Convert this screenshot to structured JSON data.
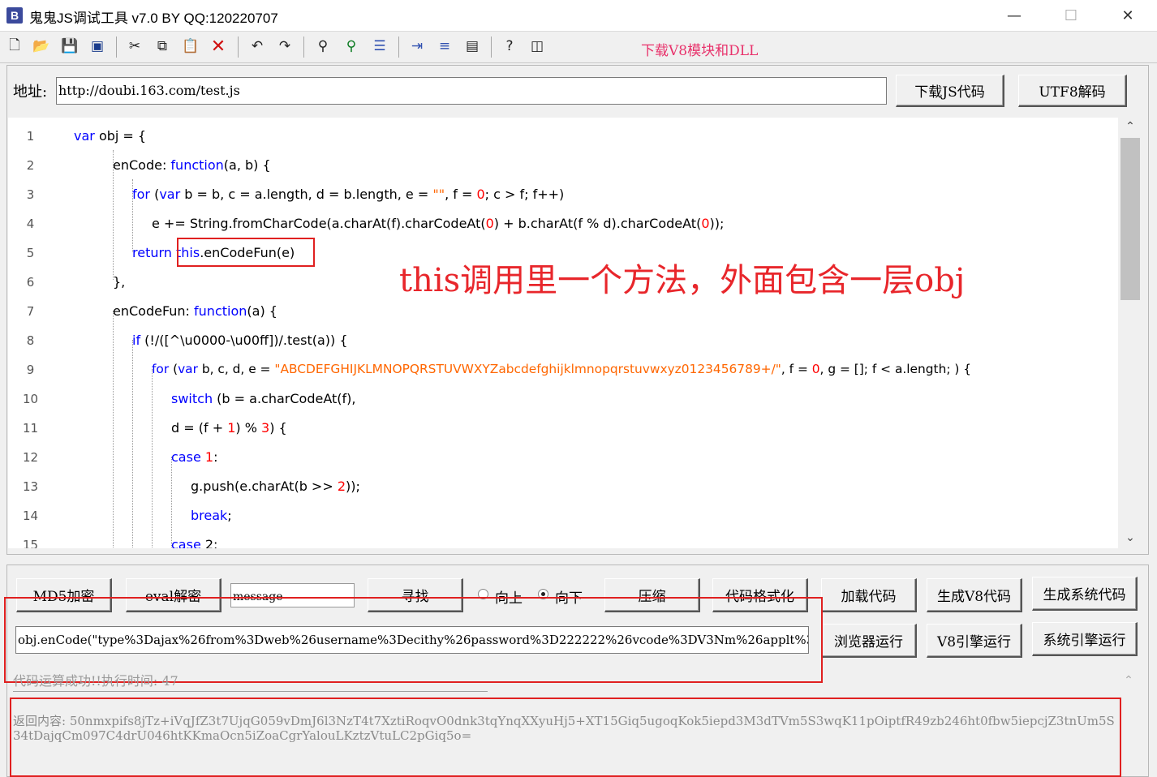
{
  "window": {
    "title": "鬼鬼JS调试工具 v7.0 BY QQ:120220707",
    "icon_letter": "B",
    "controls": {
      "minimize": "—",
      "maximize": "☐",
      "close": "✕"
    }
  },
  "toolbar": {
    "icons": [
      "new-file-icon",
      "open-folder-icon",
      "save-icon",
      "save-all-icon",
      "cut-icon",
      "copy-icon",
      "paste-icon",
      "delete-icon",
      "undo-icon",
      "redo-icon",
      "find-icon",
      "find-next-icon",
      "list-icon",
      "indent-icon",
      "numbered-list-icon",
      "window-icon",
      "help-icon",
      "split-icon"
    ],
    "download_v8_link": "下载V8模块和DLL"
  },
  "address": {
    "label": "地址:",
    "value": "http://doubi.163.com/test.js",
    "download_button": "下载JS代码",
    "utf8_button": "UTF8解码"
  },
  "editor": {
    "lines": [
      {
        "n": "1"
      },
      {
        "n": "2"
      },
      {
        "n": "3"
      },
      {
        "n": "4"
      },
      {
        "n": "5"
      },
      {
        "n": "6"
      },
      {
        "n": "7"
      },
      {
        "n": "8"
      },
      {
        "n": "9"
      },
      {
        "n": "10"
      },
      {
        "n": "11"
      },
      {
        "n": "12"
      },
      {
        "n": "13"
      },
      {
        "n": "14"
      },
      {
        "n": "15"
      }
    ],
    "code": {
      "l1_kw": "var",
      "l1_rest": " obj = {",
      "l2_a": "enCode: ",
      "l2_kw": "function",
      "l2_b": "(a, b) {",
      "l3_kw1": "for",
      "l3_a": " (",
      "l3_kw2": "var",
      "l3_b": " b = b, c = a.length, d = b.length, e = ",
      "l3_str": "\"\"",
      "l3_c": ", f = ",
      "l3_num": "0",
      "l3_d": "; c > f; f++)",
      "l4_a": "e += String.fromCharCode(a.charAt(f).charCodeAt(",
      "l4_num1": "0",
      "l4_b": ") + b.charAt(f % d).charCodeAt(",
      "l4_num2": "0",
      "l4_c": "));",
      "l5_kw": "return",
      "l5_kw2": "this",
      "l5_rest": ".enCodeFun(e)",
      "l6": "},",
      "l7_a": "enCodeFun: ",
      "l7_kw": "function",
      "l7_b": "(a) {",
      "l8_kw": "if",
      "l8_rest": " (!/([^\\u0000-\\u00ff])/.test(a)) {",
      "l9_kw1": "for",
      "l9_a": " (",
      "l9_kw2": "var",
      "l9_b": " b, c, d, e = ",
      "l9_str": "\"ABCDEFGHIJKLMNOPQRSTUVWXYZabcdefghijklmnopqrstuvwxyz0123456789+/\"",
      "l9_c": ", f = ",
      "l9_num": "0",
      "l9_d": ", g = []; f < a.length; ) {",
      "l10_kw": "switch",
      "l10_rest": " (b = a.charCodeAt(f),",
      "l11_a": "d = (f + ",
      "l11_num1": "1",
      "l11_b": ") % ",
      "l11_num2": "3",
      "l11_c": ") {",
      "l12_kw": "case",
      "l12_a": " ",
      "l12_num": "1",
      "l12_b": ":",
      "l13_a": "g.push(e.charAt(b >> ",
      "l13_num": "2",
      "l13_b": "));",
      "l14_kw": "break",
      "l14_b": ";",
      "l15_kw": "case",
      "l15_a": " 2:"
    },
    "annotation": "this调用里一个方法，外面包含一层obj"
  },
  "controls": {
    "md5_button": "MD5加密",
    "eval_button": "eval解密",
    "message_value": "message",
    "find_button": "寻找",
    "radio_up": "向上",
    "radio_down": "向下",
    "compress_button": "压缩",
    "format_button": "代码格式化",
    "load_button": "加载代码",
    "gen_v8_button": "生成V8代码",
    "gen_sys_button": "生成系统代码",
    "code_input": "obj.enCode(\"type%3Dajax%26from%3Dweb%26username%3Decithy%26password%3D222222%26vcode%3DV3Nm%26applt%3Dweb%2",
    "browser_run_button": "浏览器运行",
    "v8_run_button": "V8引擎运行",
    "sys_run_button": "系统引擎运行"
  },
  "output": {
    "status": "代码运算成功!!执行时间: 47",
    "result": "返回内容: 50nmxpifs8jTz+iVqJfZ3t7UjqG059vDmJ6l3NzT4t7XztiRoqvO0dnk3tqYnqXXyuHj5+XT15Giq5ugoqKok5iepd3M3dTVm5S3wqK11pOiptfR49zb246ht0fbw5iepcjZ3tnUm5S34tDajqCm097C4drU046htKKmaOcn5iZoaCgrYalouLKztzVtuLC2pGiq5o="
  }
}
